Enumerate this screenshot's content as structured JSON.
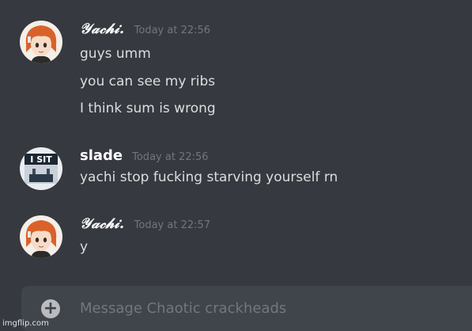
{
  "messages": [
    {
      "author": "𝒴𝒶𝒸𝒽𝒾.",
      "author_style": "script",
      "avatar_icon": "anime-girl-avatar-icon",
      "timestamp": "Today at 22:56",
      "lines": [
        "guys umm",
        "you can see my ribs",
        "I think sum is wrong"
      ]
    },
    {
      "author": "slade",
      "author_style": "plain",
      "avatar_icon": "i-sit-avatar-icon",
      "avatar_text": "I SIT",
      "timestamp": "Today at 22:56",
      "lines": [
        "yachi stop fucking starving yourself rn"
      ]
    },
    {
      "author": "𝒴𝒶𝒸𝒽𝒾.",
      "author_style": "script",
      "avatar_icon": "anime-girl-avatar-icon",
      "timestamp": "Today at 22:57",
      "lines": [
        "y"
      ]
    }
  ],
  "composer": {
    "plus_icon": "plus-circle-icon",
    "placeholder": "Message Chaotic crackheads"
  },
  "watermark": "imgflip.com",
  "colors": {
    "background": "#36393f",
    "composer_background": "#40444b",
    "text": "#dcddde",
    "timestamp": "#72767d",
    "username": "#ffffff"
  }
}
